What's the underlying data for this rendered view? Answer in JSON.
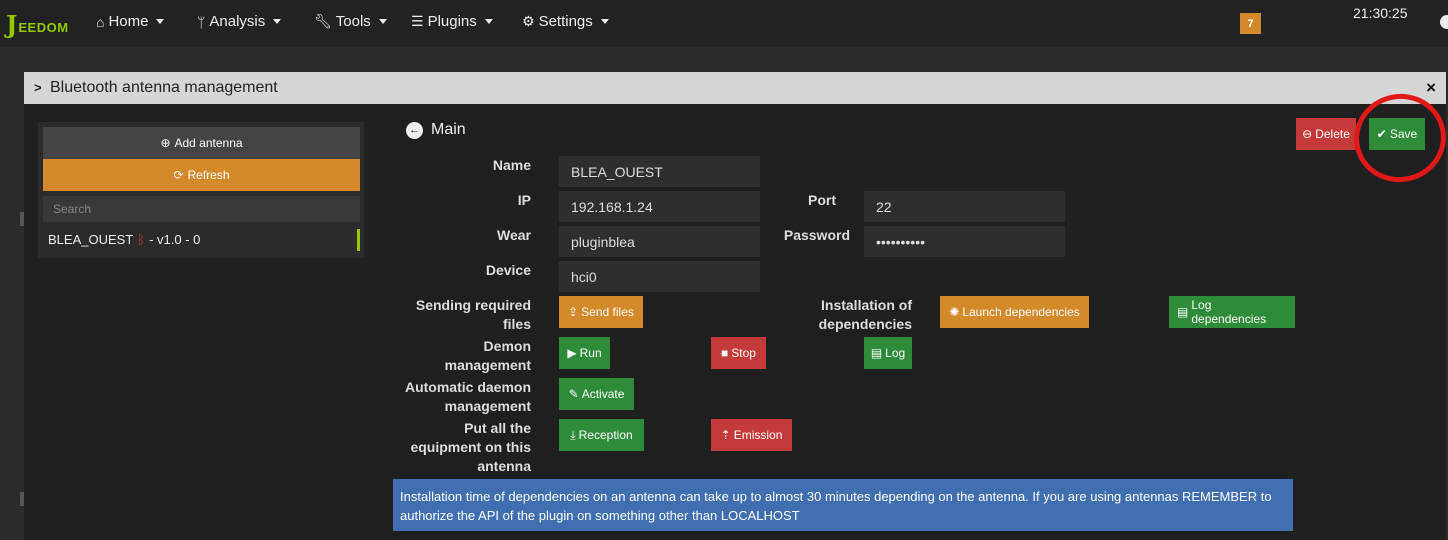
{
  "nav": {
    "logo_letter": "J",
    "logo_text": "EEDOM",
    "items": [
      {
        "label": "Home",
        "icon": "home-icon"
      },
      {
        "label": "Analysis",
        "icon": "stethoscope-icon"
      },
      {
        "label": "Tools",
        "icon": "wrench-icon"
      },
      {
        "label": "Plugins",
        "icon": "tasks-icon"
      },
      {
        "label": "Settings",
        "icon": "gear-icon"
      }
    ],
    "badge": "7",
    "clock": "21:30:25"
  },
  "modal": {
    "title": "Bluetooth antenna management",
    "close": "×"
  },
  "left": {
    "add_label": "Add antenna",
    "refresh_label": "Refresh",
    "search_placeholder": "Search",
    "antenna": {
      "name": "BLEA_OUEST",
      "version": "- v1.0 - 0"
    }
  },
  "main": {
    "title": "Main",
    "delete_label": "Delete",
    "save_label": "Save",
    "labels": {
      "name": "Name",
      "ip": "IP",
      "port": "Port",
      "wear": "Wear",
      "password": "Password",
      "device": "Device",
      "sending_1": "Sending required",
      "sending_2": "files",
      "install_1": "Installation of",
      "install_2": "dependencies",
      "demon_1": "Demon",
      "demon_2": "management",
      "auto_1": "Automatic daemon",
      "auto_2": "management",
      "put_1": "Put all the",
      "put_2": "equipment on this",
      "put_3": "antenna"
    },
    "values": {
      "name": "BLEA_OUEST",
      "ip": "192.168.1.24",
      "port": "22",
      "wear": "pluginblea",
      "password": "••••••••••",
      "device": "hci0"
    },
    "buttons": {
      "send_files": "Send files",
      "launch_deps": "Launch dependencies",
      "log_deps": "Log dependencies",
      "run": "Run",
      "stop": "Stop",
      "log": "Log",
      "activate": "Activate",
      "reception": "Reception",
      "emission": "Emission"
    },
    "info": "Installation time of dependencies on an antenna can take up to almost 30 minutes depending on the antenna. If you are using antennas REMEMBER to authorize the API of the plugin on something other than LOCALHOST"
  },
  "colors": {
    "accent_green": "#93ca02",
    "orange": "#d4892a",
    "green": "#2e8b3a",
    "red": "#c4393a",
    "info_blue": "#3f6fb0",
    "annotation_red": "#e01818"
  }
}
